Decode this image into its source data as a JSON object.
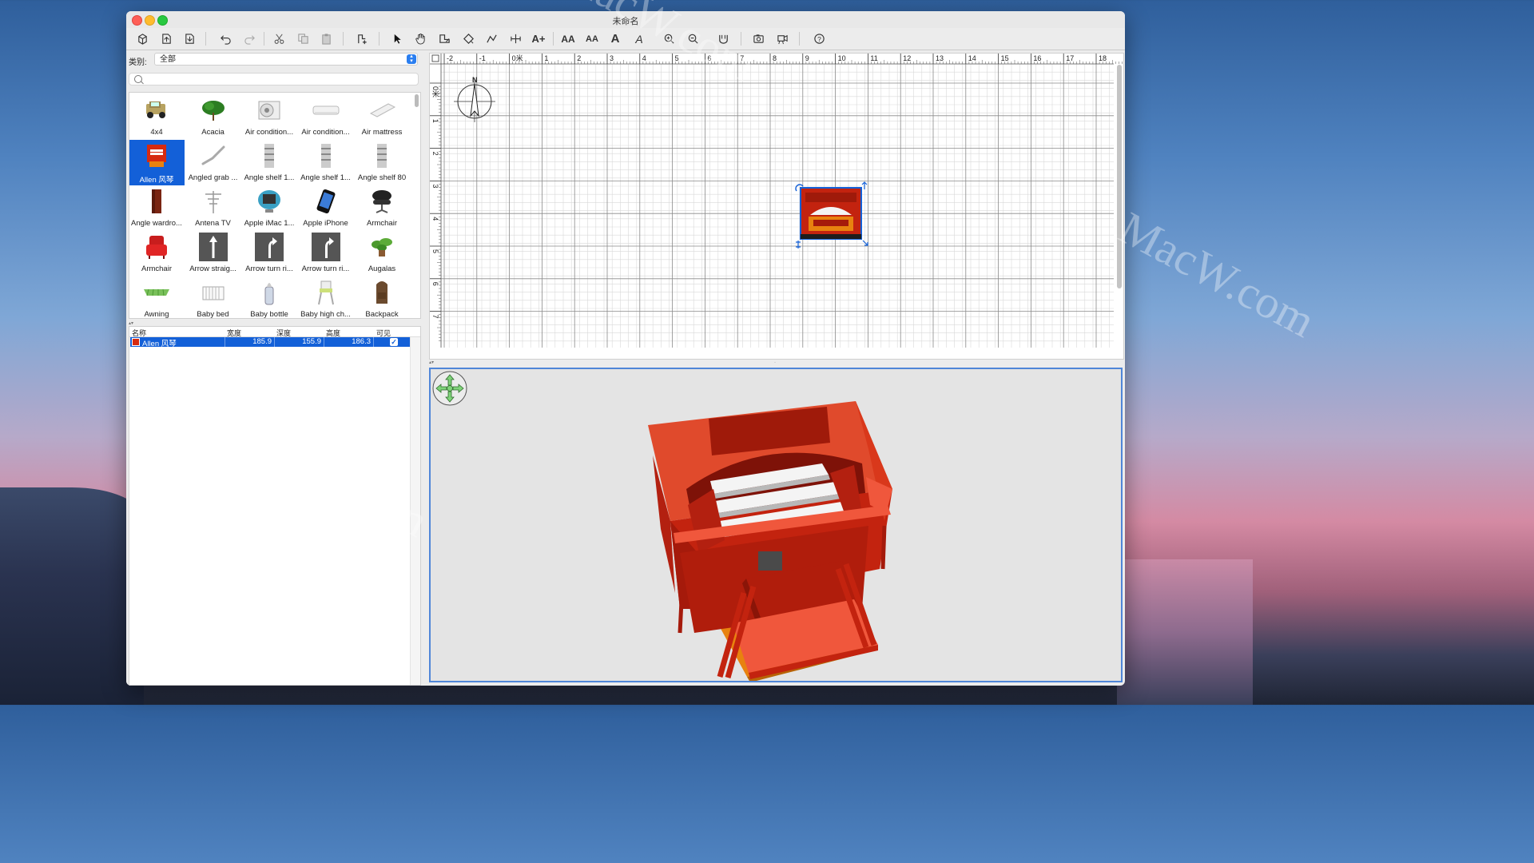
{
  "window": {
    "title": "未命名"
  },
  "watermark": "MacW.com",
  "toolbar": {
    "buttons": [
      {
        "name": "new-home-icon"
      },
      {
        "name": "open-icon"
      },
      {
        "name": "save-icon"
      },
      {
        "name": "undo-icon"
      },
      {
        "name": "redo-icon"
      },
      {
        "name": "cut-icon"
      },
      {
        "name": "copy-icon"
      },
      {
        "name": "paste-icon"
      },
      {
        "name": "add-furniture-icon"
      },
      {
        "name": "select-arrow-icon"
      },
      {
        "name": "pan-hand-icon"
      },
      {
        "name": "create-walls-icon"
      },
      {
        "name": "create-rooms-icon"
      },
      {
        "name": "create-polylines-icon"
      },
      {
        "name": "create-dimensions-icon"
      },
      {
        "name": "add-text-icon"
      },
      {
        "name": "text-larger-icon"
      },
      {
        "name": "text-smaller-icon"
      },
      {
        "name": "text-bold-icon"
      },
      {
        "name": "text-italic-icon"
      },
      {
        "name": "zoom-in-icon"
      },
      {
        "name": "zoom-out-icon"
      },
      {
        "name": "import-furniture-icon"
      },
      {
        "name": "create-photo-icon"
      },
      {
        "name": "create-video-icon"
      },
      {
        "name": "help-icon"
      }
    ],
    "text_labels": {
      "larger": "AA",
      "smaller": "AA",
      "bold": "A",
      "italic": "A",
      "add_text": "A+"
    }
  },
  "catalog": {
    "category_label": "类别:",
    "category_value": "全部",
    "search_placeholder": "",
    "items": [
      {
        "label": "4x4",
        "icon": "car-icon"
      },
      {
        "label": "Acacia",
        "icon": "tree-icon"
      },
      {
        "label": "Air condition...",
        "icon": "air-conditioner-outdoor-icon"
      },
      {
        "label": "Air condition...",
        "icon": "air-conditioner-indoor-icon"
      },
      {
        "label": "Air mattress",
        "icon": "mattress-icon"
      },
      {
        "label": "Allen 风琴",
        "icon": "organ-icon",
        "selected": true
      },
      {
        "label": "Angled grab ...",
        "icon": "grab-bar-icon"
      },
      {
        "label": "Angle shelf 1...",
        "icon": "shelf-icon"
      },
      {
        "label": "Angle shelf 1...",
        "icon": "shelf-icon"
      },
      {
        "label": "Angle shelf 80",
        "icon": "shelf-icon"
      },
      {
        "label": "Angle wardro...",
        "icon": "wardrobe-icon"
      },
      {
        "label": "Antena TV",
        "icon": "antenna-icon"
      },
      {
        "label": "Apple iMac 1...",
        "icon": "imac-icon"
      },
      {
        "label": "Apple iPhone",
        "icon": "iphone-icon"
      },
      {
        "label": "Armchair",
        "icon": "office-armchair-icon"
      },
      {
        "label": "Armchair",
        "icon": "red-armchair-icon"
      },
      {
        "label": "Arrow straig...",
        "icon": "arrow-straight-icon"
      },
      {
        "label": "Arrow turn ri...",
        "icon": "arrow-turn-icon"
      },
      {
        "label": "Arrow turn ri...",
        "icon": "arrow-turn-icon"
      },
      {
        "label": "Augalas",
        "icon": "plant-icon"
      },
      {
        "label": "Awning",
        "icon": "awning-icon"
      },
      {
        "label": "Baby bed",
        "icon": "baby-bed-icon"
      },
      {
        "label": "Baby bottle",
        "icon": "baby-bottle-icon"
      },
      {
        "label": "Baby high ch...",
        "icon": "high-chair-icon"
      },
      {
        "label": "Backpack",
        "icon": "backpack-icon"
      }
    ]
  },
  "furniture_table": {
    "headers": {
      "name": "名称",
      "width": "宽度",
      "depth": "深度",
      "height": "高度",
      "visible": "可见"
    },
    "rows": [
      {
        "name": "Allen 风琴",
        "width": "185.9",
        "depth": "155.9",
        "height": "186.3",
        "visible": true
      }
    ]
  },
  "plan": {
    "ruler_x": [
      "-2",
      "-1",
      "0米",
      "1",
      "2",
      "3",
      "4",
      "5",
      "6",
      "7",
      "8",
      "9",
      "10",
      "11",
      "12",
      "13",
      "14",
      "15",
      "16",
      "17",
      "18"
    ],
    "ruler_y": [
      "0米",
      "1",
      "2",
      "3",
      "4",
      "5",
      "6",
      "7"
    ],
    "compass_label": "N"
  },
  "colors": {
    "accent": "#1360d8",
    "organ_red": "#d62a10",
    "organ_dark": "#a51a0b",
    "organ_light": "#f0573c",
    "pedal_orange": "#e8820f"
  }
}
